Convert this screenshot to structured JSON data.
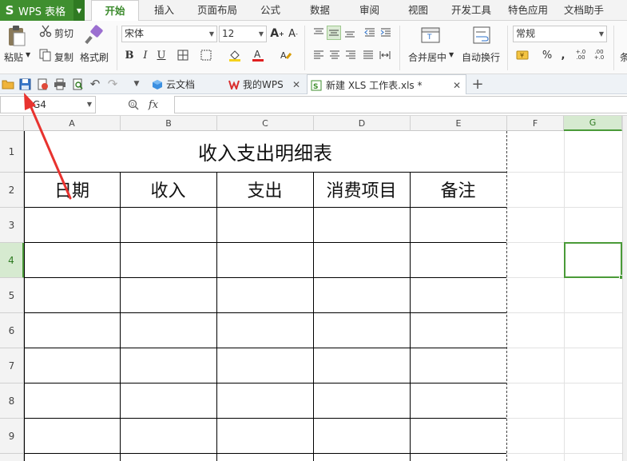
{
  "app": {
    "name": "WPS 表格",
    "logo_letter": "S"
  },
  "menu": {
    "tabs": [
      "开始",
      "插入",
      "页面布局",
      "公式",
      "数据",
      "审阅",
      "视图",
      "开发工具",
      "特色应用",
      "文档助手"
    ],
    "active": "开始"
  },
  "ribbon": {
    "paste": "粘贴",
    "cut": "剪切",
    "copy": "复制",
    "format_painter": "格式刷",
    "font_name": "宋体",
    "font_size": "12",
    "bold": "B",
    "italic": "I",
    "underline": "U",
    "merge_center": "合并居中",
    "wrap_text": "自动换行",
    "number_format": "常规",
    "percent": "%",
    "comma": ",",
    "increase_decimal": "+.0\n.00",
    "decrease_decimal": ".00\n+.0",
    "cut_off_label": "条"
  },
  "doc_tabs": [
    {
      "label": "云文档",
      "closable": false
    },
    {
      "label": "我的WPS",
      "closable": true
    },
    {
      "label": "新建 XLS 工作表.xls *",
      "closable": true,
      "active": true
    }
  ],
  "formula_bar": {
    "cell_ref": "G4",
    "fx": "fx",
    "value": ""
  },
  "sheet": {
    "columns": [
      "A",
      "B",
      "C",
      "D",
      "E",
      "F",
      "G"
    ],
    "rows": [
      "1",
      "2",
      "3",
      "4",
      "5",
      "6",
      "7",
      "8",
      "9"
    ],
    "selected_cell": "G4",
    "title": "收入支出明细表",
    "headers": [
      "日期",
      "收入",
      "支出",
      "消费项目",
      "备注"
    ]
  },
  "colors": {
    "accent_green": "#3f8f2f",
    "selection_green": "#4a9a38",
    "annotation_red": "#e8332f"
  }
}
